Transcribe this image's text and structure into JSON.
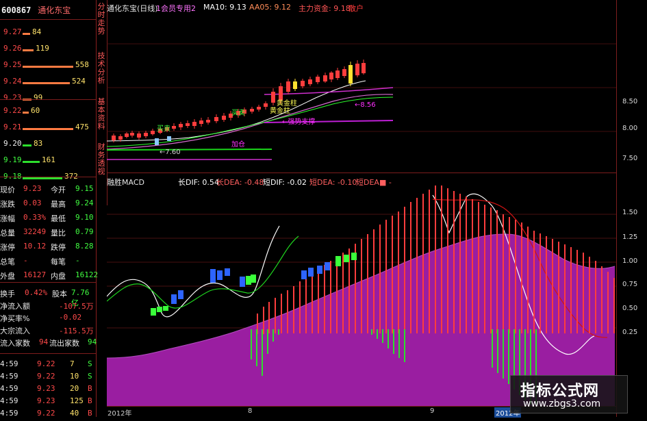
{
  "header": {
    "stock_code": "600867",
    "stock_name": "通化东宝",
    "top_chart_title": "通化东宝(日线)",
    "indicator_label": "1会员专用2",
    "ma10_label": "MA10: 9.13",
    "aa05_label": "AA05: 9.12",
    "main_fund_label": "主力资金: 9.18",
    "buy_point_label": "散户",
    "macd_title": "融胜MACD",
    "long_dif": "长DIF: 0.54",
    "long_dea": "长DEA: -0.48",
    "short_dif": "短DIF: -0.02",
    "short_dea": "短DEA: -0.10",
    "short_dea_extra": "短DEA■ -"
  },
  "side_tabs": [
    "分时走势",
    "技术分析",
    "基本资料",
    "财务透视"
  ],
  "order_book": {
    "asks": [
      {
        "price": "9.27",
        "vol": "84"
      },
      {
        "price": "9.26",
        "vol": "119"
      },
      {
        "price": "9.25",
        "vol": "558"
      },
      {
        "price": "9.24",
        "vol": "524"
      },
      {
        "price": "9.23",
        "vol": "99"
      }
    ],
    "bids": [
      {
        "price": "9.22",
        "vol": "60"
      },
      {
        "price": "9.21",
        "vol": "475"
      },
      {
        "price": "9.20",
        "vol": "83"
      },
      {
        "price": "9.19",
        "vol": "161"
      },
      {
        "price": "9.18",
        "vol": "372"
      }
    ]
  },
  "stats": [
    {
      "label": "现价",
      "value": "9.23",
      "label2": "今开",
      "value2": "9.15"
    },
    {
      "label": "涨跌",
      "value": "0.03",
      "label2": "最高",
      "value2": "9.24"
    },
    {
      "label": "涨幅",
      "value": "0.33%",
      "label2": "最低",
      "value2": "9.10"
    },
    {
      "label": "总量",
      "value": "32249",
      "label2": "量比",
      "value2": "0.79"
    },
    {
      "label": "涨停",
      "value": "10.12",
      "label2": "跌停",
      "value2": "8.28"
    },
    {
      "label": "总笔",
      "value": "-",
      "label2": "每笔",
      "value2": "-"
    },
    {
      "label": "外盘",
      "value": "16127",
      "label2": "内盘",
      "value2": "16122"
    }
  ],
  "fund_flow": [
    {
      "label": "换手",
      "value": "0.42%",
      "label2": "股本",
      "value2": "7.76亿"
    },
    {
      "label": "净流入额",
      "value": "-107.5万"
    },
    {
      "label": "净买率%",
      "value": "-0.02"
    },
    {
      "label": "大宗流入",
      "value": "-115.5万"
    },
    {
      "label": "流入家数",
      "value": "94",
      "label2": "流出家数",
      "value2": "94"
    }
  ],
  "trades": [
    {
      "time": "4:59",
      "price": "9.22",
      "vol": "7",
      "side": "S"
    },
    {
      "time": "4:59",
      "price": "9.22",
      "vol": "10",
      "side": "S"
    },
    {
      "time": "4:59",
      "price": "9.23",
      "vol": "20",
      "side": "B"
    },
    {
      "time": "4:59",
      "price": "9.23",
      "vol": "125",
      "side": "B"
    },
    {
      "time": "4:59",
      "price": "9.22",
      "vol": "40",
      "side": "B"
    }
  ],
  "top_annotations": {
    "buy_gold": "黄金柱",
    "buy_gold_2": "黄金柱",
    "buy_small": "买卖",
    "support": "←7.60",
    "line_label_1": "←8.56",
    "line_label_2": "←强势支撑",
    "yellow_line": "→黄金线",
    "note_1": "加仓"
  },
  "axes": {
    "top_ticks": [
      "8.50",
      "8.00",
      "7.50"
    ],
    "macd_ticks": [
      "1.50",
      "1.25",
      "1.00",
      "0.75",
      "0.50",
      "0.25"
    ],
    "bottom_labels": [
      "2012年",
      "8",
      "9",
      "2012年"
    ]
  },
  "watermark": {
    "line1": "指标公式网",
    "line2": "www.zbgs3.com"
  },
  "colors": {
    "red": "#ff4a4a",
    "green": "#41ff41",
    "purple": "#9b1ea2",
    "magenta_line": "#cf47d6",
    "white": "#efefef"
  }
}
